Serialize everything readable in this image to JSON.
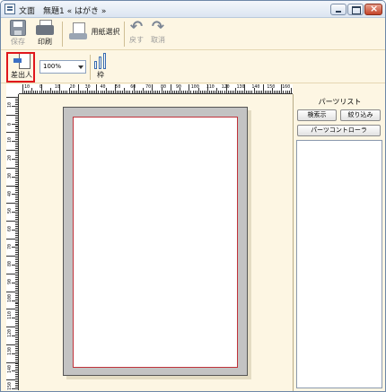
{
  "window": {
    "title": "文面　無題1 « はがき »"
  },
  "toolbar1": {
    "save_label": "保存",
    "print_label": "印刷",
    "paper_label": "用紙選択",
    "undo_label": "戻す",
    "redo_label": "取消"
  },
  "toolbar2": {
    "sender_label": "差出人",
    "zoom_value": "100%",
    "frame_label": "枠"
  },
  "ruler": {
    "top_numbers": [
      "10",
      "0",
      "10",
      "20",
      "30",
      "40",
      "50",
      "60",
      "70",
      "80",
      "90",
      "100",
      "110",
      "120",
      "130",
      "140",
      "150",
      "160"
    ],
    "left_numbers": [
      "10",
      "0",
      "10",
      "20",
      "30",
      "40",
      "50",
      "60",
      "70",
      "80",
      "90",
      "100",
      "110",
      "120",
      "130",
      "140",
      "150",
      "160"
    ]
  },
  "parts_panel": {
    "title": "パーツリスト",
    "search_label": "検索示",
    "filter_label": "絞り込み",
    "controller_label": "パーツコントローラ"
  },
  "colors": {
    "highlight": "#e0161b",
    "card_border": "#c0323a",
    "background": "#fdf6e3"
  }
}
